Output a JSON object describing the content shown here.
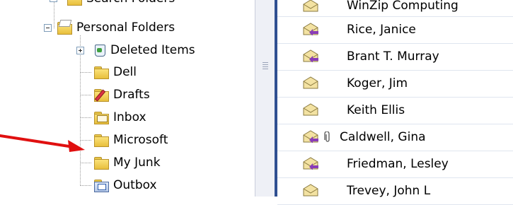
{
  "folder_tree": {
    "top_partial_label": "Search Folders",
    "root": {
      "label": "Personal Folders",
      "expanded": true
    },
    "folders": [
      {
        "label": "Deleted Items",
        "icon": "deleted-items-icon",
        "expandable": true
      },
      {
        "label": "Dell",
        "icon": "folder-icon"
      },
      {
        "label": "Drafts",
        "icon": "drafts-icon"
      },
      {
        "label": "Inbox",
        "icon": "inbox-icon"
      },
      {
        "label": "Microsoft",
        "icon": "folder-icon"
      },
      {
        "label": "My Junk",
        "icon": "folder-icon",
        "highlighted_by_arrow": true
      },
      {
        "label": "Outbox",
        "icon": "outbox-icon"
      }
    ]
  },
  "message_list": {
    "rows": [
      {
        "sender": "WinZip Computing",
        "icon": "read-envelope-icon",
        "attachment": false
      },
      {
        "sender": "Rice, Janice",
        "icon": "replied-envelope-icon",
        "attachment": false
      },
      {
        "sender": "Brant T. Murray",
        "icon": "replied-envelope-icon",
        "attachment": false
      },
      {
        "sender": "Koger, Jim",
        "icon": "read-envelope-icon",
        "attachment": false
      },
      {
        "sender": "Keith Ellis",
        "icon": "read-envelope-icon",
        "attachment": false
      },
      {
        "sender": "Caldwell, Gina",
        "icon": "replied-envelope-icon",
        "attachment": true
      },
      {
        "sender": "Friedman, Lesley",
        "icon": "replied-envelope-icon",
        "attachment": false
      },
      {
        "sender": "Trevey, John L",
        "icon": "read-envelope-icon",
        "attachment": false
      }
    ]
  },
  "colors": {
    "arrow": "#e01010",
    "pane_border": "#2f4f91",
    "folder": "#f2cf55"
  }
}
